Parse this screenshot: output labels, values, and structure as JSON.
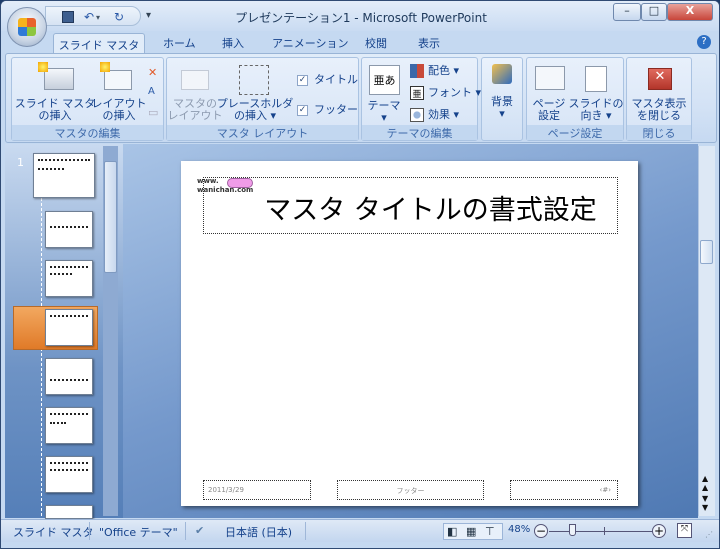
{
  "window": {
    "title": "プレゼンテーション1 - Microsoft PowerPoint",
    "minimize": "–",
    "maximize": "□",
    "close": "X"
  },
  "qat": {
    "save": "save-icon",
    "undo": "↶",
    "redo": "↻",
    "customize": "▾"
  },
  "tabs": [
    {
      "label": "スライド マスタ",
      "active": true
    },
    {
      "label": "ホーム"
    },
    {
      "label": "挿入"
    },
    {
      "label": "アニメーション"
    },
    {
      "label": "校閲"
    },
    {
      "label": "表示"
    }
  ],
  "help": "?",
  "ribbon": {
    "edit_master": {
      "label": "マスタの編集",
      "insert_slide_master": [
        "スライド マスタ",
        "の挿入"
      ],
      "insert_layout": [
        "レイアウト",
        "の挿入"
      ]
    },
    "master_layout": {
      "label": "マスタ レイアウト",
      "master_layout_btn": [
        "マスタの",
        "レイアウト"
      ],
      "insert_placeholder": [
        "プレースホルダ",
        "の挿入 ▾"
      ],
      "title_check": "タイトル",
      "footer_check": "フッター",
      "title_checked": true,
      "footer_checked": true
    },
    "edit_theme": {
      "label": "テーマの編集",
      "themes": "テーマ",
      "theme_glyph": "亜あ",
      "colors": "配色 ▾",
      "fonts": "フォント ▾",
      "effects": "効果 ▾"
    },
    "background": {
      "label": "背景"
    },
    "page_setup": {
      "label": "ページ設定",
      "page_setup_btn": [
        "ページ",
        "設定"
      ],
      "orientation": [
        "スライドの",
        "向き ▾"
      ]
    },
    "close": {
      "label": "閉じる",
      "close_master": [
        "マスタ表示",
        "を閉じる"
      ]
    }
  },
  "thumbnails": {
    "master_number": "1",
    "selected_index": 3,
    "count": 8
  },
  "slide": {
    "title": "マスタ タイトルの書式設定",
    "logo": [
      "www.",
      "wanichan.com"
    ],
    "date": "2011/3/29",
    "footer": "フッター",
    "number": "‹#›"
  },
  "status": {
    "view": "スライド マスタ",
    "theme": "\"Office テーマ\"",
    "language": "日本語 (日本)",
    "zoom": "48%",
    "zoom_level": 48
  },
  "colors": {
    "accent_orange": "#e07a28",
    "ribbon": "#d3e2f5",
    "close_red": "#c8453a"
  }
}
